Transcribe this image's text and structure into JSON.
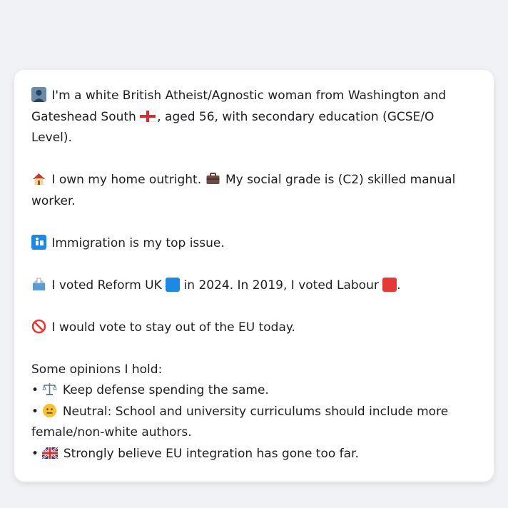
{
  "persona": {
    "p1": {
      "intro": "I'm a white British Atheist/Agnostic woman from Washington and Gateshead South",
      "after_flag": ", aged 56, with secondary education (GCSE/O Level)."
    },
    "p2": {
      "home": "I own my home outright.",
      "grade": "My social grade is (C2) skilled manual worker."
    },
    "p3": {
      "issue": "Immigration is my top issue."
    },
    "p4": {
      "voted_2024_prefix": "I voted Reform UK",
      "voted_2024_suffix": "in 2024. In 2019, I voted Labour",
      "period": "."
    },
    "p5": {
      "eu": "I would vote to stay out of the EU today."
    },
    "opinions": {
      "heading": "Some opinions I hold:",
      "bullet": "•",
      "items": [
        {
          "icon": "scales-icon",
          "text": "Keep defense spending the same."
        },
        {
          "icon": "neutral-face-icon",
          "text": "Neutral: School and university curriculums should include more female/non-white authors."
        },
        {
          "icon": "uk-flag-icon",
          "text": "Strongly believe EU integration has gone too far."
        }
      ]
    }
  },
  "colors": {
    "page_bg": "#f0f2f5",
    "bubble_bg": "#ffffff",
    "reform_blue": "#1e88e5",
    "labour_red": "#e53935"
  }
}
